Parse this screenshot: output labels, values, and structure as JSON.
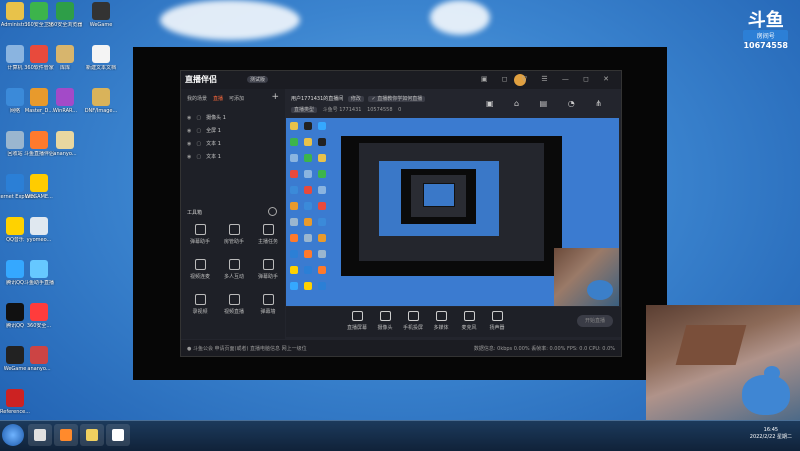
{
  "desktop": {
    "icons": [
      {
        "label": "Administr...",
        "color": "#e8c24a"
      },
      {
        "label": "360安全卫士",
        "color": "#3cb44b"
      },
      {
        "label": "360安全浏览器",
        "color": "#2e9e48"
      },
      {
        "label": "WeGame",
        "color": "#333333"
      },
      {
        "label": "计算机",
        "color": "#8ab4e0"
      },
      {
        "label": "360软件管家",
        "color": "#e84a3c"
      },
      {
        "label": "库库",
        "color": "#d7b56d"
      },
      {
        "label": "新建文本文档",
        "color": "#f4f4f4"
      },
      {
        "label": "网络",
        "color": "#3b8ad9"
      },
      {
        "label": "Master_D...",
        "color": "#e89a2c"
      },
      {
        "label": "WinRAR...",
        "color": "#a34ac8"
      },
      {
        "label": "回收站",
        "color": "#9ab6cf"
      },
      {
        "label": "斗鱼直播伴侣",
        "color": "#ff7a2c"
      },
      {
        "label": "ananyo...",
        "color": "#e8d7a0"
      },
      {
        "label": "DNF/Image...",
        "color": "#d9b35a"
      },
      {
        "label": "Internet Explorer",
        "color": "#2b7fd6"
      },
      {
        "label": "WEGAME...",
        "color": "#ffcc00"
      },
      {
        "label": "QQ音乐",
        "color": "#ffd200"
      },
      {
        "label": "yyomeo...",
        "color": "#e0e8f0"
      },
      {
        "label": "腾讯QQ",
        "color": "#35a8ff"
      },
      {
        "label": "斗鱼助手直播",
        "color": "#66c8ff"
      },
      {
        "label": "腾讯QQ",
        "color": "#111111"
      },
      {
        "label": "WeGame",
        "color": "#222222"
      },
      {
        "label": "360安全...",
        "color": "#ff3c3c"
      },
      {
        "label": "Reference...",
        "color": "#cc2222"
      },
      {
        "label": "ananyo...",
        "color": "#cc4444"
      }
    ]
  },
  "watermark": {
    "logo": "斗鱼",
    "room_label": "房间号",
    "room_number": "10674558"
  },
  "app": {
    "brand": "直播伴侣",
    "brand_tag": "测试版",
    "window_buttons": "▣ ◻ ▽ ☰ — ◻ ✕",
    "sidebar_tabs": [
      {
        "label": "我的场景",
        "active": false
      },
      {
        "label": "直播",
        "active": true
      },
      {
        "label": "可添加",
        "active": false
      }
    ],
    "add_symbol": "+",
    "scenes": [
      {
        "label": "摄像头 1"
      },
      {
        "label": "全屏 1"
      },
      {
        "label": "文本 1"
      },
      {
        "label": "文本 1"
      }
    ],
    "tools_header": "工具箱",
    "tools": [
      {
        "label": "弹幕助手"
      },
      {
        "label": "房管助手"
      },
      {
        "label": "主播任务"
      },
      {
        "label": "视频连麦"
      },
      {
        "label": "多人互动"
      },
      {
        "label": "弹幕助手"
      },
      {
        "label": "录视频"
      },
      {
        "label": "视频直播"
      },
      {
        "label": "弹幕墙"
      }
    ],
    "header": {
      "title": "用户1771431的直播间",
      "chip1": "修改",
      "chip2": "✓ 直播教你学如何直播",
      "category_btn": "直播类型",
      "room_label": "斗鱼号 1771431",
      "room_id": "10574558",
      "viewers": "0"
    },
    "header_icons": "▣ ⌂ ▤ ◔ ⋔",
    "bottom_buttons": [
      {
        "label": "直播屏幕"
      },
      {
        "label": "摄像头"
      },
      {
        "label": "手机投屏"
      },
      {
        "label": "多媒体"
      },
      {
        "label": "麦克风"
      },
      {
        "label": "扬声器"
      }
    ],
    "start_live": "开始直播",
    "status": {
      "left": "● 斗鱼公会    申请页面(或者)    直播电脑信息    网上一级位",
      "right": "数据信息: 0kbps   0.00% 丢帧率: 0.00%   FPS: 0.0   CPU: 0.0%"
    }
  },
  "taskbar": {
    "items": [
      {
        "color": "#e0e0e0"
      },
      {
        "color": "#ff8a2c"
      },
      {
        "color": "#f0d060"
      },
      {
        "color": "#ffffff"
      }
    ],
    "clock_time": "16:45",
    "clock_date": "2022/2/22 星期二"
  }
}
